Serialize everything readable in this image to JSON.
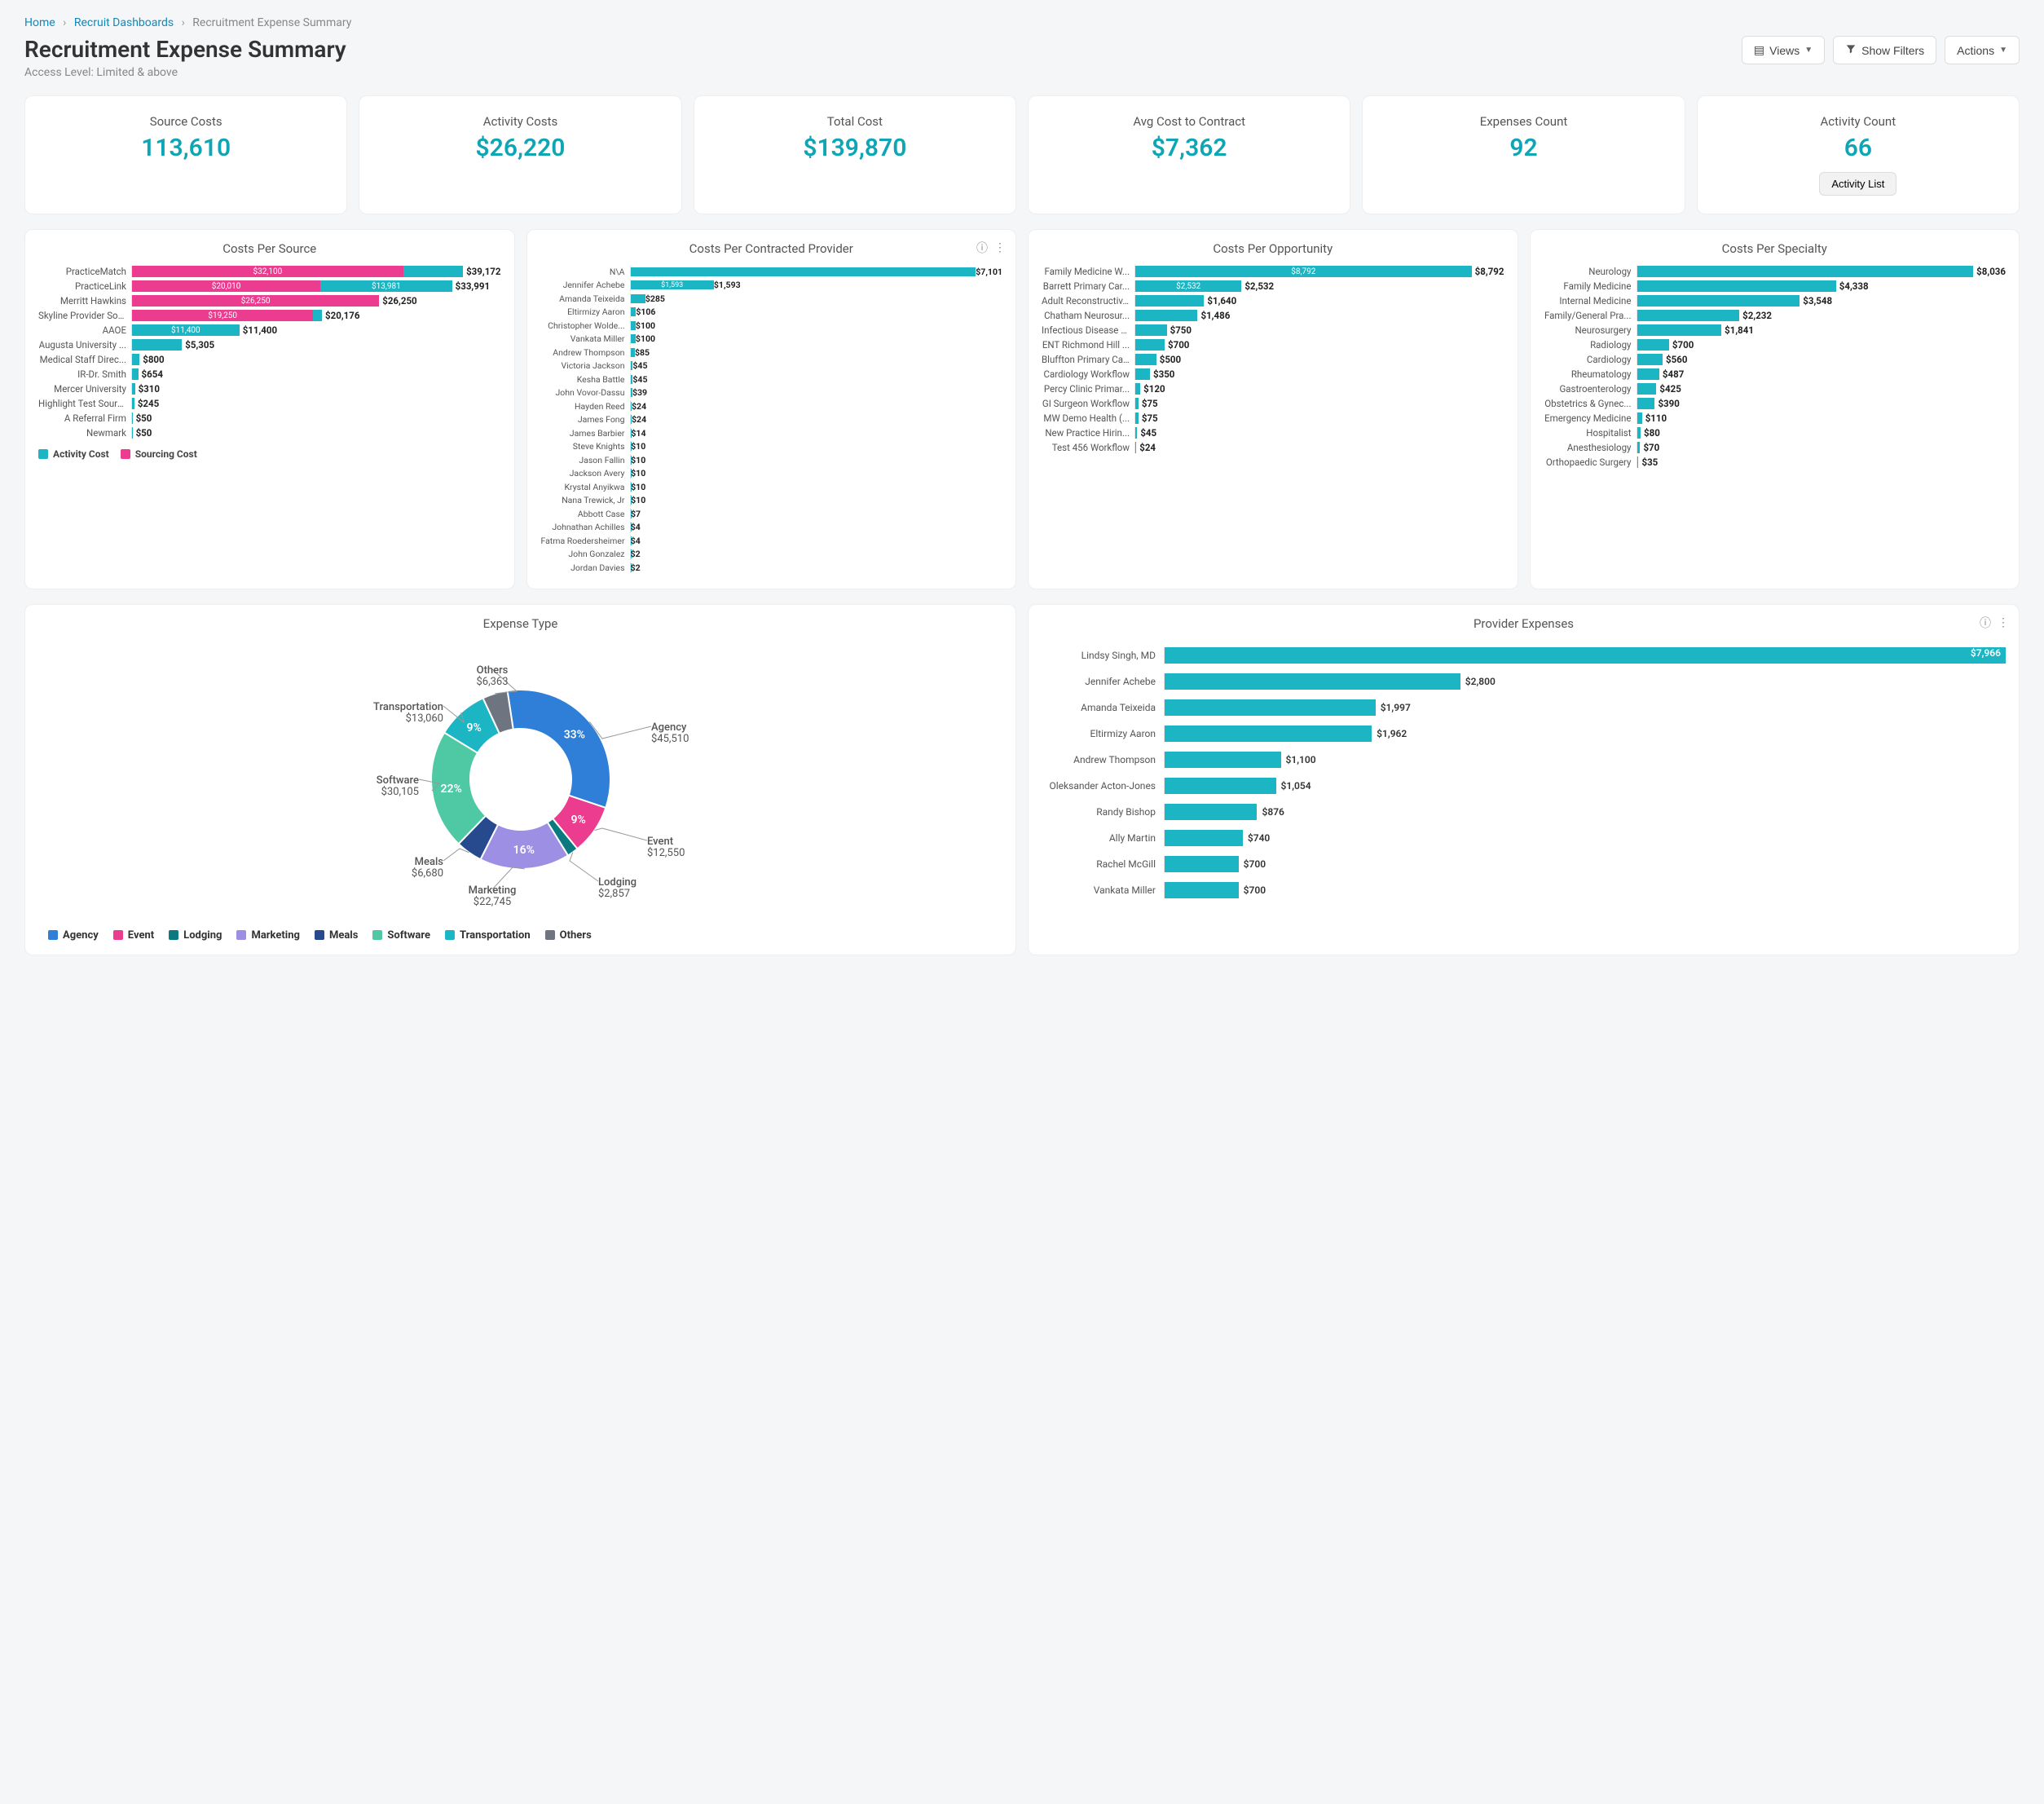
{
  "breadcrumb": {
    "home": "Home",
    "dashboards": "Recruit Dashboards",
    "current": "Recruitment Expense Summary"
  },
  "header": {
    "title": "Recruitment Expense Summary",
    "access": "Access Level: Limited & above",
    "views": "Views",
    "show_filters": "Show Filters",
    "actions": "Actions"
  },
  "kpis": [
    {
      "label": "Source Costs",
      "value": "113,610"
    },
    {
      "label": "Activity Costs",
      "value": "$26,220"
    },
    {
      "label": "Total Cost",
      "value": "$139,870"
    },
    {
      "label": "Avg Cost to Contract",
      "value": "$7,362"
    },
    {
      "label": "Expenses Count",
      "value": "92"
    },
    {
      "label": "Activity Count",
      "value": "66",
      "button": "Activity List"
    }
  ],
  "costs_per_source": {
    "title": "Costs Per Source",
    "legend": {
      "activity": "Activity Cost",
      "sourcing": "Sourcing Cost"
    }
  },
  "costs_per_contracted": {
    "title": "Costs Per Contracted Provider"
  },
  "costs_per_opportunity": {
    "title": "Costs Per Opportunity"
  },
  "costs_per_specialty": {
    "title": "Costs Per Specialty"
  },
  "expense_type": {
    "title": "Expense Type",
    "others_label": "Others"
  },
  "provider_expenses": {
    "title": "Provider Expenses"
  },
  "colors": {
    "teal": "#1bb5c4",
    "pink": "#ec3c8f",
    "blue": "#2f7ed8",
    "green": "#4fc9a3",
    "purple": "#9d8fe3",
    "navy": "#274a8f",
    "darkteal": "#0a7a80",
    "gray": "#6e7580"
  },
  "chart_data": {
    "costs_per_source": {
      "type": "bar",
      "orientation": "horizontal",
      "stacked": true,
      "series_names": [
        "Sourcing Cost",
        "Activity Cost"
      ],
      "categories": [
        "PracticeMatch",
        "PracticeLink",
        "Merritt Hawkins",
        "Skyline Provider Sol...",
        "AAOE",
        "Augusta University ...",
        "Medical Staff Direc...",
        "IR-Dr. Smith",
        "Mercer University",
        "Highlight Test Source",
        "A Referral Firm",
        "Newmark"
      ],
      "series": [
        {
          "name": "Sourcing Cost",
          "values": [
            32100,
            20010,
            26250,
            19250,
            0,
            0,
            0,
            0,
            0,
            0,
            0,
            0
          ],
          "labels": [
            "$32,100",
            "$20,010",
            "$26,250",
            "$19,250",
            "",
            "",
            "",
            "",
            "",
            "",
            "",
            ""
          ]
        },
        {
          "name": "Activity Cost",
          "values": [
            7072,
            13981,
            0,
            926,
            11400,
            5305,
            800,
            654,
            310,
            245,
            50,
            50
          ],
          "labels": [
            "",
            "$13,981",
            "",
            "",
            "$11,400",
            "",
            "",
            "",
            "",
            "",
            "",
            ""
          ]
        }
      ],
      "totals": [
        "$39,172",
        "$33,991",
        "$26,250",
        "$20,176",
        "$11,400",
        "$5,305",
        "$800",
        "$654",
        "$310",
        "$245",
        "$50",
        "$50"
      ],
      "max": 39172
    },
    "costs_per_contracted": {
      "type": "bar",
      "orientation": "horizontal",
      "categories": [
        "N\\A",
        "Jennifer Achebe",
        "Amanda Teixeida",
        "Eltirmizy Aaron",
        "Christopher Wolde...",
        "Vankata Miller",
        "Andrew Thompson",
        "Victoria Jackson",
        "Kesha Battle",
        "John Vovor-Dassu",
        "Hayden Reed",
        "James Fong",
        "James Barbier",
        "Steve Knights",
        "Jason Fallin",
        "Jackson Avery",
        "Krystal Anyikwa",
        "Nana Trewick, Jr",
        "Abbott Case",
        "Johnathan Achilles",
        "Fatma Roedersheimer",
        "John Gonzalez",
        "Jordan Davies"
      ],
      "values": [
        7101,
        1593,
        285,
        106,
        100,
        100,
        85,
        45,
        45,
        39,
        24,
        24,
        14,
        10,
        10,
        10,
        10,
        10,
        7,
        4,
        4,
        2,
        2
      ],
      "labels": [
        "$7,101",
        "$1,593",
        "$285",
        "$106",
        "$100",
        "$100",
        "$85",
        "$45",
        "$45",
        "$39",
        "$24",
        "$24",
        "$14",
        "$10",
        "$10",
        "$10",
        "$10",
        "$10",
        "$7",
        "$4",
        "$4",
        "$2",
        "$2"
      ],
      "inbar_labels": [
        "",
        "$1,593",
        "",
        "",
        "",
        "",
        "",
        "",
        "",
        "",
        "",
        "",
        "",
        "",
        "",
        "",
        "",
        "",
        "",
        "",
        "",
        "",
        ""
      ],
      "max": 7101,
      "line_overlay": true
    },
    "costs_per_opportunity": {
      "type": "bar",
      "orientation": "horizontal",
      "categories": [
        "Family Medicine W...",
        "Barrett Primary Car...",
        "Adult Reconstructiv...",
        "Chatham Neurosur...",
        "Infectious Disease S...",
        "ENT Richmond Hill ...",
        "Bluffton Primary Ca...",
        "Cardiology Workflow",
        "Percy Clinic Primar...",
        "GI Surgeon Workflow",
        "MW Demo Health (...",
        "New Practice Hirin...",
        "Test 456 Workflow"
      ],
      "values": [
        8792,
        2532,
        1640,
        1486,
        750,
        700,
        500,
        350,
        120,
        75,
        75,
        45,
        24
      ],
      "labels": [
        "$8,792",
        "$2,532",
        "$1,640",
        "$1,486",
        "$750",
        "$700",
        "$500",
        "$350",
        "$120",
        "$75",
        "$75",
        "$45",
        "$24"
      ],
      "inbar_labels": [
        "$8,792",
        "$2,532",
        "",
        "",
        "",
        "",
        "",
        "",
        "",
        "",
        "",
        "",
        ""
      ],
      "max": 8792
    },
    "costs_per_specialty": {
      "type": "bar",
      "orientation": "horizontal",
      "categories": [
        "Neurology",
        "Family Medicine",
        "Internal Medicine",
        "Family/General Pra...",
        "Neurosurgery",
        "Radiology",
        "Cardiology",
        "Rheumatology",
        "Gastroenterology",
        "Obstetrics & Gynec...",
        "Emergency Medicine",
        "Hospitalist",
        "Anesthesiology",
        "Orthopaedic Surgery"
      ],
      "values": [
        8036,
        4338,
        3548,
        2232,
        1841,
        700,
        560,
        487,
        425,
        390,
        110,
        80,
        70,
        35
      ],
      "labels": [
        "$8,036",
        "$4,338",
        "$3,548",
        "$2,232",
        "$1,841",
        "$700",
        "$560",
        "$487",
        "$425",
        "$390",
        "$110",
        "$80",
        "$70",
        "$35"
      ],
      "max": 8036
    },
    "expense_type": {
      "type": "pie",
      "slices": [
        {
          "name": "Agency",
          "value": 45510,
          "label": "$45,510",
          "pct": "33%",
          "color": "#2f7ed8"
        },
        {
          "name": "Event",
          "value": 12550,
          "label": "$12,550",
          "pct": "9%",
          "color": "#ec3c8f"
        },
        {
          "name": "Lodging",
          "value": 2857,
          "label": "$2,857",
          "pct": "",
          "color": "#0a7a80"
        },
        {
          "name": "Marketing",
          "value": 22745,
          "label": "$22,745",
          "pct": "16%",
          "color": "#9d8fe3"
        },
        {
          "name": "Meals",
          "value": 6680,
          "label": "$6,680",
          "pct": "",
          "color": "#274a8f"
        },
        {
          "name": "Software",
          "value": 30105,
          "label": "$30,105",
          "pct": "22%",
          "color": "#4fc9a3"
        },
        {
          "name": "Transportation",
          "value": 13060,
          "label": "$13,060",
          "pct": "9%",
          "color": "#1bb5c4"
        },
        {
          "name": "Others",
          "value": 6363,
          "label": "$6,363",
          "pct": "",
          "color": "#6e7580"
        }
      ]
    },
    "provider_expenses": {
      "type": "bar",
      "orientation": "horizontal",
      "categories": [
        "Lindsy Singh, MD",
        "Jennifer Achebe",
        "Amanda Teixeida",
        "Eltirmizy Aaron",
        "Andrew Thompson",
        "Oleksander Acton-Jones",
        "Randy Bishop",
        "Ally Martin",
        "Rachel McGill",
        "Vankata Miller"
      ],
      "values": [
        7966,
        2800,
        1997,
        1962,
        1100,
        1054,
        876,
        740,
        700,
        700
      ],
      "labels": [
        "$7,966",
        "$2,800",
        "$1,997",
        "$1,962",
        "$1,100",
        "$1,054",
        "$876",
        "$740",
        "$700",
        "$700"
      ],
      "max": 7966
    }
  }
}
